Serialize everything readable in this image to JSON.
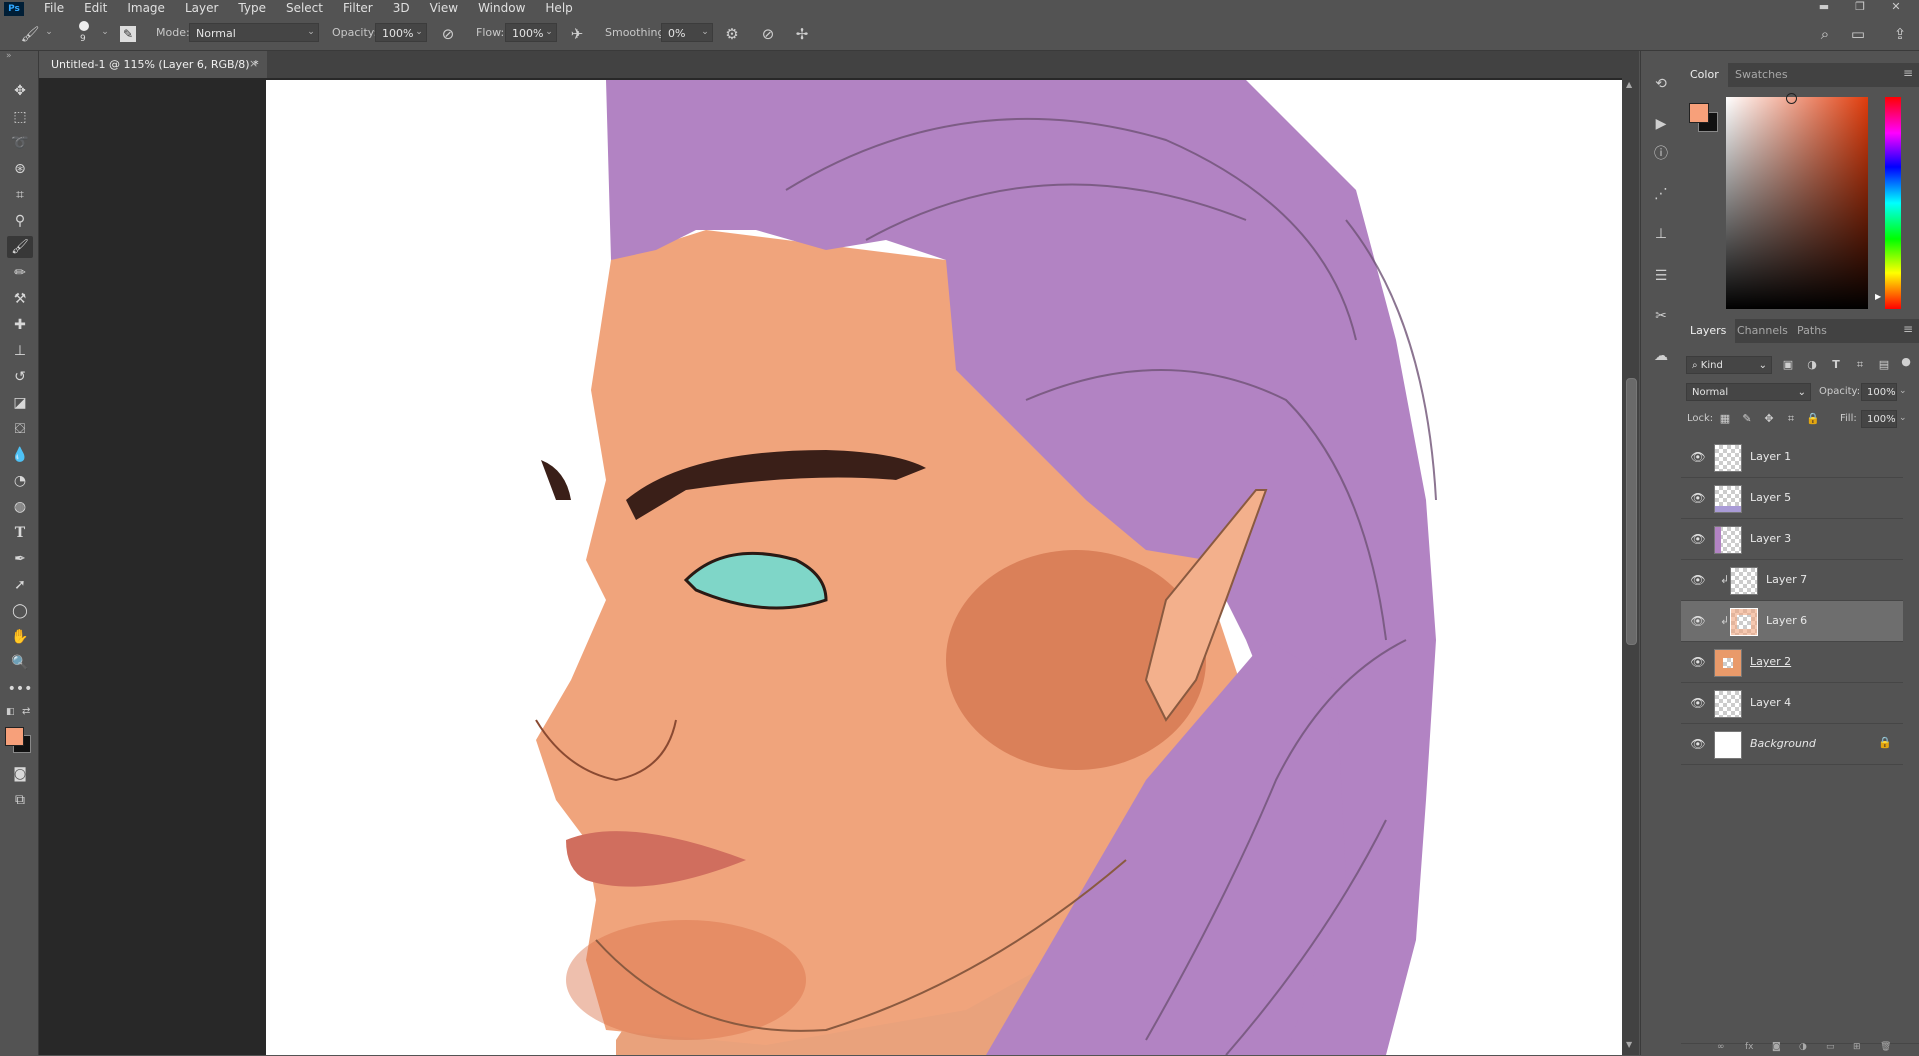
{
  "menubar": {
    "logo": "Ps",
    "items": [
      "File",
      "Edit",
      "Image",
      "Layer",
      "Type",
      "Select",
      "Filter",
      "3D",
      "View",
      "Window",
      "Help"
    ]
  },
  "options": {
    "brush_size": "9",
    "mode_label": "Mode:",
    "mode_value": "Normal",
    "opacity_label": "Opacity:",
    "opacity_value": "100%",
    "flow_label": "Flow:",
    "flow_value": "100%",
    "smoothing_label": "Smoothing:",
    "smoothing_value": "0%"
  },
  "document": {
    "tab_title": "Untitled-1 @ 115% (Layer 6, RGB/8) *",
    "close": "×"
  },
  "color_panel": {
    "tabs": [
      "Color",
      "Swatches"
    ],
    "foreground_color": "#f7a07a",
    "background_color": "#111111"
  },
  "layers_panel": {
    "tabs": [
      "Layers",
      "Channels",
      "Paths"
    ],
    "filter_kind": "Kind",
    "blend_mode": "Normal",
    "opacity_label": "Opacity:",
    "opacity_value": "100%",
    "lock_label": "Lock:",
    "fill_label": "Fill:",
    "fill_value": "100%",
    "layers": [
      {
        "name": "Layer 1",
        "visible": true,
        "selected": false,
        "clipped": false
      },
      {
        "name": "Layer 5",
        "visible": true,
        "selected": false,
        "clipped": false
      },
      {
        "name": "Layer 3",
        "visible": true,
        "selected": false,
        "clipped": false
      },
      {
        "name": "Layer 7",
        "visible": true,
        "selected": false,
        "clipped": true
      },
      {
        "name": "Layer 6",
        "visible": true,
        "selected": true,
        "clipped": true
      },
      {
        "name": "Layer 2",
        "visible": true,
        "selected": false,
        "clipped": false
      },
      {
        "name": "Layer 4",
        "visible": true,
        "selected": false,
        "clipped": false
      },
      {
        "name": "Background",
        "visible": true,
        "selected": false,
        "clipped": false,
        "locked": true
      }
    ]
  },
  "colors": {
    "hair": "#b283c3",
    "skin": "#f0a47c",
    "eye": "#7fd6c8"
  }
}
